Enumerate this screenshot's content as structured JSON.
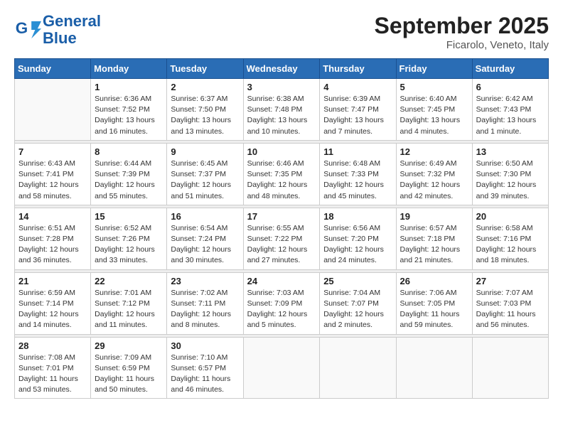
{
  "header": {
    "logo_line1": "General",
    "logo_line2": "Blue",
    "month": "September 2025",
    "location": "Ficarolo, Veneto, Italy"
  },
  "weekdays": [
    "Sunday",
    "Monday",
    "Tuesday",
    "Wednesday",
    "Thursday",
    "Friday",
    "Saturday"
  ],
  "weeks": [
    [
      {
        "num": "",
        "detail": ""
      },
      {
        "num": "1",
        "detail": "Sunrise: 6:36 AM\nSunset: 7:52 PM\nDaylight: 13 hours\nand 16 minutes."
      },
      {
        "num": "2",
        "detail": "Sunrise: 6:37 AM\nSunset: 7:50 PM\nDaylight: 13 hours\nand 13 minutes."
      },
      {
        "num": "3",
        "detail": "Sunrise: 6:38 AM\nSunset: 7:48 PM\nDaylight: 13 hours\nand 10 minutes."
      },
      {
        "num": "4",
        "detail": "Sunrise: 6:39 AM\nSunset: 7:47 PM\nDaylight: 13 hours\nand 7 minutes."
      },
      {
        "num": "5",
        "detail": "Sunrise: 6:40 AM\nSunset: 7:45 PM\nDaylight: 13 hours\nand 4 minutes."
      },
      {
        "num": "6",
        "detail": "Sunrise: 6:42 AM\nSunset: 7:43 PM\nDaylight: 13 hours\nand 1 minute."
      }
    ],
    [
      {
        "num": "7",
        "detail": "Sunrise: 6:43 AM\nSunset: 7:41 PM\nDaylight: 12 hours\nand 58 minutes."
      },
      {
        "num": "8",
        "detail": "Sunrise: 6:44 AM\nSunset: 7:39 PM\nDaylight: 12 hours\nand 55 minutes."
      },
      {
        "num": "9",
        "detail": "Sunrise: 6:45 AM\nSunset: 7:37 PM\nDaylight: 12 hours\nand 51 minutes."
      },
      {
        "num": "10",
        "detail": "Sunrise: 6:46 AM\nSunset: 7:35 PM\nDaylight: 12 hours\nand 48 minutes."
      },
      {
        "num": "11",
        "detail": "Sunrise: 6:48 AM\nSunset: 7:33 PM\nDaylight: 12 hours\nand 45 minutes."
      },
      {
        "num": "12",
        "detail": "Sunrise: 6:49 AM\nSunset: 7:32 PM\nDaylight: 12 hours\nand 42 minutes."
      },
      {
        "num": "13",
        "detail": "Sunrise: 6:50 AM\nSunset: 7:30 PM\nDaylight: 12 hours\nand 39 minutes."
      }
    ],
    [
      {
        "num": "14",
        "detail": "Sunrise: 6:51 AM\nSunset: 7:28 PM\nDaylight: 12 hours\nand 36 minutes."
      },
      {
        "num": "15",
        "detail": "Sunrise: 6:52 AM\nSunset: 7:26 PM\nDaylight: 12 hours\nand 33 minutes."
      },
      {
        "num": "16",
        "detail": "Sunrise: 6:54 AM\nSunset: 7:24 PM\nDaylight: 12 hours\nand 30 minutes."
      },
      {
        "num": "17",
        "detail": "Sunrise: 6:55 AM\nSunset: 7:22 PM\nDaylight: 12 hours\nand 27 minutes."
      },
      {
        "num": "18",
        "detail": "Sunrise: 6:56 AM\nSunset: 7:20 PM\nDaylight: 12 hours\nand 24 minutes."
      },
      {
        "num": "19",
        "detail": "Sunrise: 6:57 AM\nSunset: 7:18 PM\nDaylight: 12 hours\nand 21 minutes."
      },
      {
        "num": "20",
        "detail": "Sunrise: 6:58 AM\nSunset: 7:16 PM\nDaylight: 12 hours\nand 18 minutes."
      }
    ],
    [
      {
        "num": "21",
        "detail": "Sunrise: 6:59 AM\nSunset: 7:14 PM\nDaylight: 12 hours\nand 14 minutes."
      },
      {
        "num": "22",
        "detail": "Sunrise: 7:01 AM\nSunset: 7:12 PM\nDaylight: 12 hours\nand 11 minutes."
      },
      {
        "num": "23",
        "detail": "Sunrise: 7:02 AM\nSunset: 7:11 PM\nDaylight: 12 hours\nand 8 minutes."
      },
      {
        "num": "24",
        "detail": "Sunrise: 7:03 AM\nSunset: 7:09 PM\nDaylight: 12 hours\nand 5 minutes."
      },
      {
        "num": "25",
        "detail": "Sunrise: 7:04 AM\nSunset: 7:07 PM\nDaylight: 12 hours\nand 2 minutes."
      },
      {
        "num": "26",
        "detail": "Sunrise: 7:06 AM\nSunset: 7:05 PM\nDaylight: 11 hours\nand 59 minutes."
      },
      {
        "num": "27",
        "detail": "Sunrise: 7:07 AM\nSunset: 7:03 PM\nDaylight: 11 hours\nand 56 minutes."
      }
    ],
    [
      {
        "num": "28",
        "detail": "Sunrise: 7:08 AM\nSunset: 7:01 PM\nDaylight: 11 hours\nand 53 minutes."
      },
      {
        "num": "29",
        "detail": "Sunrise: 7:09 AM\nSunset: 6:59 PM\nDaylight: 11 hours\nand 50 minutes."
      },
      {
        "num": "30",
        "detail": "Sunrise: 7:10 AM\nSunset: 6:57 PM\nDaylight: 11 hours\nand 46 minutes."
      },
      {
        "num": "",
        "detail": ""
      },
      {
        "num": "",
        "detail": ""
      },
      {
        "num": "",
        "detail": ""
      },
      {
        "num": "",
        "detail": ""
      }
    ]
  ]
}
